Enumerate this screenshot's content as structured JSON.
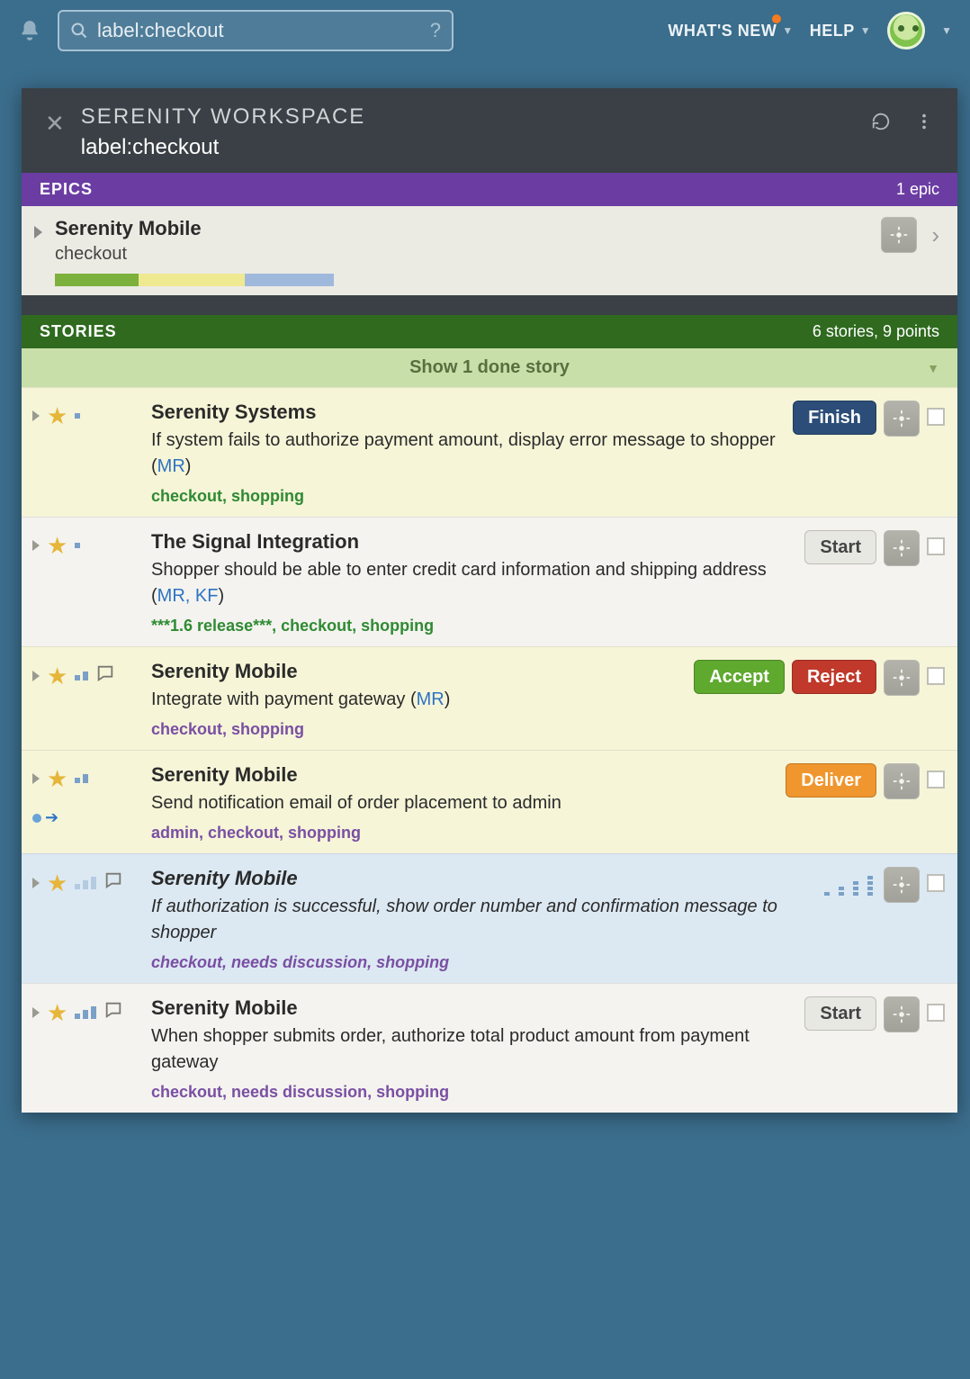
{
  "header": {
    "search_value": "label:checkout",
    "whats_new": "WHAT'S NEW",
    "help": "HELP"
  },
  "panel": {
    "workspace": "SERENITY WORKSPACE",
    "query": "label:checkout"
  },
  "epics": {
    "header": "EPICS",
    "count_text": "1 epic",
    "item": {
      "title": "Serenity Mobile",
      "subtitle": "checkout"
    }
  },
  "stories_header": {
    "title": "STORIES",
    "summary": "6 stories, 9 points",
    "done_text": "Show 1 done story"
  },
  "buttons": {
    "finish": "Finish",
    "start": "Start",
    "accept": "Accept",
    "reject": "Reject",
    "deliver": "Deliver"
  },
  "stories": [
    {
      "project": "Serenity Systems",
      "text": "If system fails to authorize payment amount, display error message to shopper (",
      "who": "MR",
      "text_close": ")",
      "tags": "checkout, shopping"
    },
    {
      "project": "The Signal Integration",
      "text": "Shopper should be able to enter credit card information and shipping address (",
      "who": "MR, KF",
      "text_close": ")",
      "tags": "***1.6 release***, checkout, shopping"
    },
    {
      "project": "Serenity Mobile",
      "text": "Integrate with payment gateway (",
      "who": "MR",
      "text_close": ")",
      "tags": "checkout, shopping"
    },
    {
      "project": "Serenity Mobile",
      "text": "Send notification email of order placement to admin",
      "who": "",
      "text_close": "",
      "tags": "admin, checkout, shopping"
    },
    {
      "project": "Serenity Mobile",
      "text": "If authorization is successful, show order number and confirmation message to shopper",
      "who": "",
      "text_close": "",
      "tags": "checkout, needs discussion, shopping"
    },
    {
      "project": "Serenity Mobile",
      "text": "When shopper submits order, authorize total product amount from payment gateway",
      "who": "",
      "text_close": "",
      "tags": "checkout, needs discussion, shopping"
    }
  ]
}
